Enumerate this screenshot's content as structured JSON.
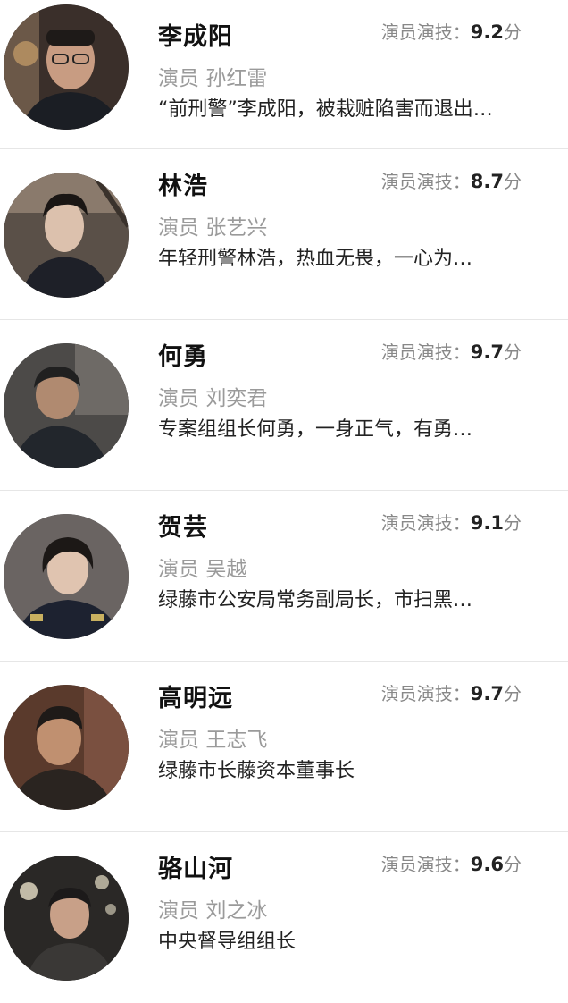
{
  "score_label": "演员演技：",
  "score_unit": "分",
  "actor_prefix": "演员",
  "characters": [
    {
      "name": "李成阳",
      "score": "9.2",
      "actor": "孙红雷",
      "desc": "“前刑警”李成阳，被栽赃陷害而退出…"
    },
    {
      "name": "林浩",
      "score": "8.7",
      "actor": "张艺兴",
      "desc": "年轻刑警林浩，热血无畏，一心为…"
    },
    {
      "name": "何勇",
      "score": "9.7",
      "actor": "刘奕君",
      "desc": "专案组组长何勇，一身正气，有勇…"
    },
    {
      "name": "贺芸",
      "score": "9.1",
      "actor": "吴越",
      "desc": "绿藤市公安局常务副局长，市扫黑…"
    },
    {
      "name": "高明远",
      "score": "9.7",
      "actor": "王志飞",
      "desc": "绿藤市长藤资本董事长"
    },
    {
      "name": "骆山河",
      "score": "9.6",
      "actor": "刘之冰",
      "desc": "中央督导组组长"
    }
  ]
}
